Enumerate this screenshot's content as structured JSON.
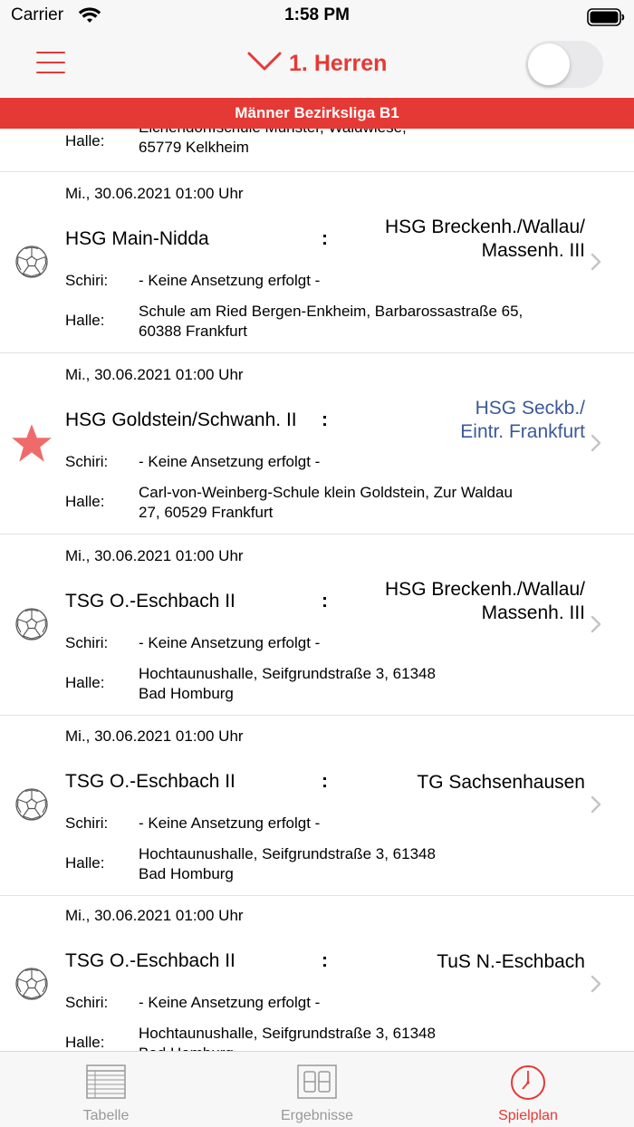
{
  "status_bar": {
    "carrier": "Carrier",
    "time": "1:58 PM"
  },
  "nav": {
    "title": "1. Herren",
    "toggle_on": false
  },
  "banner": {
    "league": "Männer Bezirksliga B1"
  },
  "labels": {
    "schiri": "Schiri:",
    "halle": "Halle:"
  },
  "partial_item": {
    "halle_label": "Halle:",
    "halle_line1": "Eichendorffschule Münster, Waldwiese,",
    "halle_line2": "65779 Kelkheim"
  },
  "matches": [
    {
      "date": "Mi., 30.06.2021 01:00 Uhr",
      "home": "HSG Main-Nidda",
      "separator": ":",
      "away_line1": "HSG Breckenh./Wallau/",
      "away_line2": "Massenh. III",
      "schiri": "- Keine Ansetzung erfolgt -",
      "halle_line1": "Schule am Ried Bergen-Enkheim, Barbarossastraße 65,",
      "halle_line2": "60388 Frankfurt",
      "icon": "handball-icon",
      "favorite": false
    },
    {
      "date": "Mi., 30.06.2021 01:00 Uhr",
      "home": "HSG Goldstein/Schwanh. II",
      "separator": ":",
      "away_line1": "HSG Seckb./",
      "away_line2": "Eintr. Frankfurt",
      "schiri": "- Keine Ansetzung erfolgt -",
      "halle_line1": "Carl-von-Weinberg-Schule klein Goldstein, Zur Waldau",
      "halle_line2": "27, 60529 Frankfurt",
      "icon": "star-icon",
      "favorite": true
    },
    {
      "date": "Mi., 30.06.2021 01:00 Uhr",
      "home": "TSG O.-Eschbach II",
      "separator": ":",
      "away_line1": "HSG Breckenh./Wallau/",
      "away_line2": "Massenh. III",
      "schiri": "- Keine Ansetzung erfolgt -",
      "halle_line1": "Hochtaunushalle, Seifgrundstraße 3, 61348",
      "halle_line2": "Bad Homburg",
      "icon": "handball-icon",
      "favorite": false
    },
    {
      "date": "Mi., 30.06.2021 01:00 Uhr",
      "home": "TSG O.-Eschbach II",
      "separator": ":",
      "away_line1": "TG Sachsenhausen",
      "away_line2": "",
      "schiri": "- Keine Ansetzung erfolgt -",
      "halle_line1": "Hochtaunushalle, Seifgrundstraße 3, 61348",
      "halle_line2": "Bad Homburg",
      "icon": "handball-icon",
      "favorite": false
    },
    {
      "date": "Mi., 30.06.2021 01:00 Uhr",
      "home": "TSG O.-Eschbach II",
      "separator": ":",
      "away_line1": "TuS N.-Eschbach",
      "away_line2": "",
      "schiri": "- Keine Ansetzung erfolgt -",
      "halle_line1": "Hochtaunushalle, Seifgrundstraße 3, 61348",
      "halle_line2": "Bad Homburg",
      "icon": "handball-icon",
      "favorite": false
    }
  ],
  "tabs": [
    {
      "label": "Tabelle",
      "icon": "table-icon",
      "active": false
    },
    {
      "label": "Ergebnisse",
      "icon": "scoreboard-icon",
      "active": false
    },
    {
      "label": "Spielplan",
      "icon": "clock-icon",
      "active": true
    }
  ],
  "colors": {
    "accent": "#e53935",
    "favorite_team": "#3b5998",
    "inactive": "#999999"
  }
}
